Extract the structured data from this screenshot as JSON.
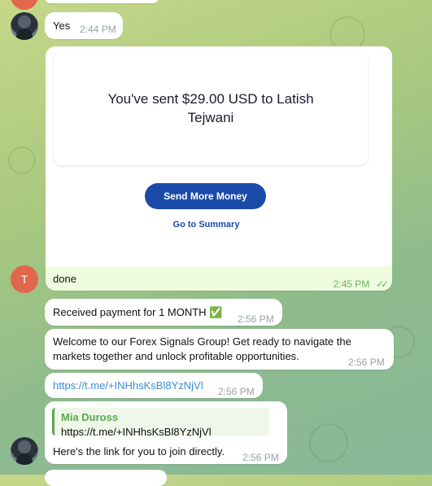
{
  "messages": {
    "yes": {
      "text": "Yes",
      "time": "2:44 PM"
    },
    "receipt": {
      "headline": "You've sent $29.00 USD to Latish Tejwani",
      "send_more": "Send More Money",
      "go_summary": "Go to Summary"
    },
    "done": {
      "avatar_letter": "T",
      "text": "done",
      "time": "2:45 PM"
    },
    "payment": {
      "text": "Received payment for 1 MONTH ✅",
      "time": "2:56 PM"
    },
    "welcome": {
      "text": "Welcome to our Forex Signals Group! Get ready to navigate the markets together and unlock profitable opportunities.",
      "time": "2:56 PM"
    },
    "link": {
      "text": "https://t.me/+INHhsKsBl8YzNjVl",
      "time": "2:56 PM"
    },
    "join": {
      "reply_author": "Mia Duross",
      "reply_text": "https://t.me/+INHhsKsBl8YzNjVl",
      "text": "Here's the link for you to join directly.",
      "time": "2:56 PM"
    }
  }
}
